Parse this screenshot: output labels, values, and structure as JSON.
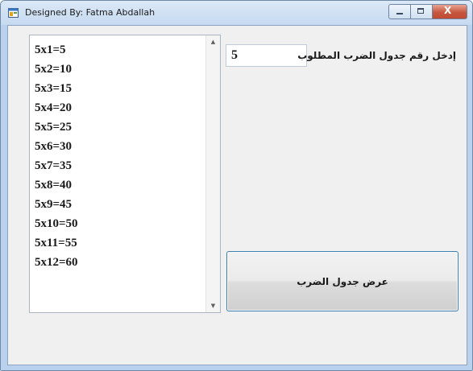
{
  "window": {
    "title": "Designed By: Fatma Abdallah",
    "icon": "winforms-app-icon",
    "controls": {
      "minimize_icon": "minimize-icon",
      "maximize_icon": "maximize-icon",
      "close_icon": "close-icon",
      "close_glyph": "X"
    }
  },
  "form": {
    "prompt_label": "إدخل رقم جدول الضرب المطلوب",
    "number_input": {
      "value": "5",
      "placeholder": ""
    },
    "show_button_label": "عرض جدول الضرب",
    "results": [
      "5x1=5",
      "5x2=10",
      "5x3=15",
      "5x4=20",
      "5x5=25",
      "5x6=30",
      "5x7=35",
      "5x8=40",
      "5x9=45",
      "5x10=50",
      "5x11=55",
      "5x12=60"
    ],
    "scroll_up_glyph": "▲",
    "scroll_down_glyph": "▼"
  },
  "colors": {
    "titlebar": "#c6daf0",
    "client_background": "#f0f0f0",
    "button_border": "#3c7fb1",
    "close_button": "#c7563f"
  }
}
